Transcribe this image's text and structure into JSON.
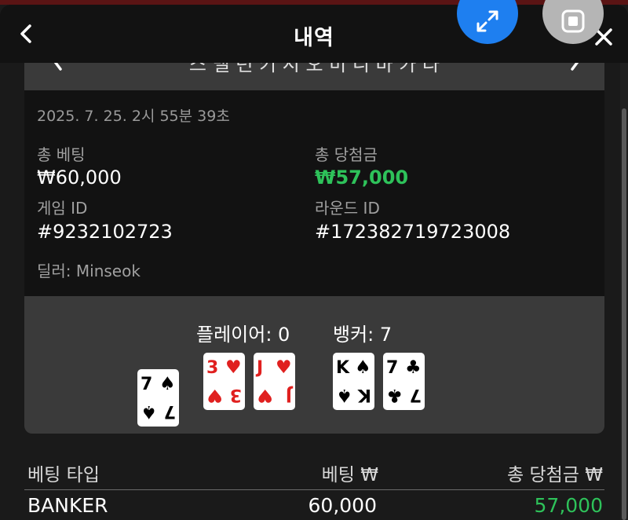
{
  "header": {
    "title": "내역"
  },
  "nav": {
    "label": "스 맬 런 키 시 오 미 니 바 카 라"
  },
  "round_info": {
    "timestamp": "2025. 7. 25. 2시 55분 39초",
    "total_bet_label": "총 베팅",
    "total_bet_value": "₩60,000",
    "total_win_label": "총 당첨금",
    "total_win_value": "₩57,000",
    "game_id_label": "게임 ID",
    "game_id_value": "#9232102723",
    "round_id_label": "라운드 ID",
    "round_id_value": "#172382719723008",
    "dealer": "딜러: Minseok"
  },
  "hands": {
    "player_label": "플레이어: 0",
    "banker_label": "뱅커: 7",
    "player_cards": [
      {
        "rank": "7",
        "suit": "♠",
        "color": "#000000",
        "rotated": true
      },
      {
        "rank": "3",
        "suit": "♥",
        "color": "#e0201f",
        "rotated": false
      },
      {
        "rank": "J",
        "suit": "♥",
        "color": "#e0201f",
        "rotated": false
      }
    ],
    "banker_cards": [
      {
        "rank": "K",
        "suit": "♠",
        "color": "#000000",
        "rotated": false
      },
      {
        "rank": "7",
        "suit": "♣",
        "color": "#000000",
        "rotated": false
      }
    ]
  },
  "bet_table": {
    "headers": [
      "베팅 타입",
      "베팅 ₩",
      "총 당첨금 ₩"
    ],
    "rows": [
      {
        "type": "BANKER",
        "bet": "60,000",
        "win": "57,000"
      }
    ]
  },
  "colors": {
    "accent_blue": "#1e7ff0",
    "win_green": "#2ec25a",
    "card_red": "#e0201f"
  },
  "icons": [
    "chevron-left-icon",
    "close-icon",
    "expand-icon",
    "window-icon",
    "chevron-right-icon"
  ]
}
